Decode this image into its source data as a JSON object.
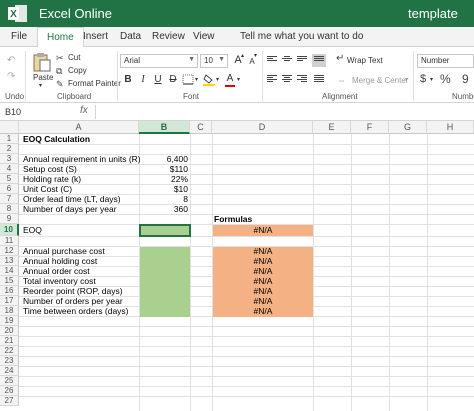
{
  "app": {
    "title": "Excel Online",
    "document": "template"
  },
  "tabs": [
    "File",
    "Home",
    "Insert",
    "Data",
    "Review",
    "View",
    "Tell me what you want to do"
  ],
  "ribbon": {
    "undo_label": "Undo",
    "clipboard": {
      "paste": "Paste",
      "cut": "Cut",
      "copy": "Copy",
      "format_painter": "Format Painter",
      "group": "Clipboard"
    },
    "font": {
      "name": "Arial",
      "size": "10",
      "bold": "B",
      "italic": "I",
      "underline": "U",
      "strike": "D",
      "grow": "A",
      "shrink": "A",
      "group": "Font"
    },
    "alignment": {
      "wrap": "Wrap Text",
      "merge": "Merge & Center",
      "group": "Alignment"
    },
    "number": {
      "format": "Number",
      "currency": "$",
      "percent": "%",
      "comma": "9",
      "group": "Number"
    }
  },
  "formula_bar": {
    "name_box": "B10",
    "fx": "fx",
    "formula": ""
  },
  "columns": [
    "A",
    "B",
    "C",
    "D",
    "E",
    "F",
    "G",
    "H"
  ],
  "selected_column": "B",
  "selected_row": "10",
  "rows": [
    "1",
    "2",
    "3",
    "4",
    "5",
    "6",
    "7",
    "8",
    "9",
    "10",
    "11",
    "12",
    "13",
    "14",
    "15",
    "16",
    "17",
    "18",
    "19",
    "20",
    "21",
    "22",
    "23",
    "24",
    "25",
    "26",
    "27"
  ],
  "sheet": {
    "a1": "EOQ Calculation",
    "inputs": [
      {
        "label": "Annual requirement in units (R)",
        "value": "6,400"
      },
      {
        "label": "Setup cost (S)",
        "value": "$110"
      },
      {
        "label": "Holding rate (k)",
        "value": "22%"
      },
      {
        "label": "Unit Cost (C)",
        "value": "$10"
      },
      {
        "label": "Order lead time (LT, days)",
        "value": "8"
      },
      {
        "label": "Number of days per year",
        "value": "360"
      }
    ],
    "formulas_header": "Formulas",
    "eoq": {
      "label": "EOQ",
      "formula": "#N/A"
    },
    "outputs": [
      {
        "label": "Annual purchase cost",
        "formula": "#N/A"
      },
      {
        "label": "Annual holding cost",
        "formula": "#N/A"
      },
      {
        "label": "Annual order cost",
        "formula": "#N/A"
      },
      {
        "label": "Total inventory cost",
        "formula": "#N/A"
      },
      {
        "label": "Reorder point (ROP, days)",
        "formula": "#N/A"
      },
      {
        "label": "Number of orders per year",
        "formula": "#N/A"
      },
      {
        "label": "Time between orders (days)",
        "formula": "#N/A"
      }
    ]
  },
  "colors": {
    "brand": "#217346",
    "input_fill": "#a9d08e",
    "formula_fill": "#f4b183"
  }
}
